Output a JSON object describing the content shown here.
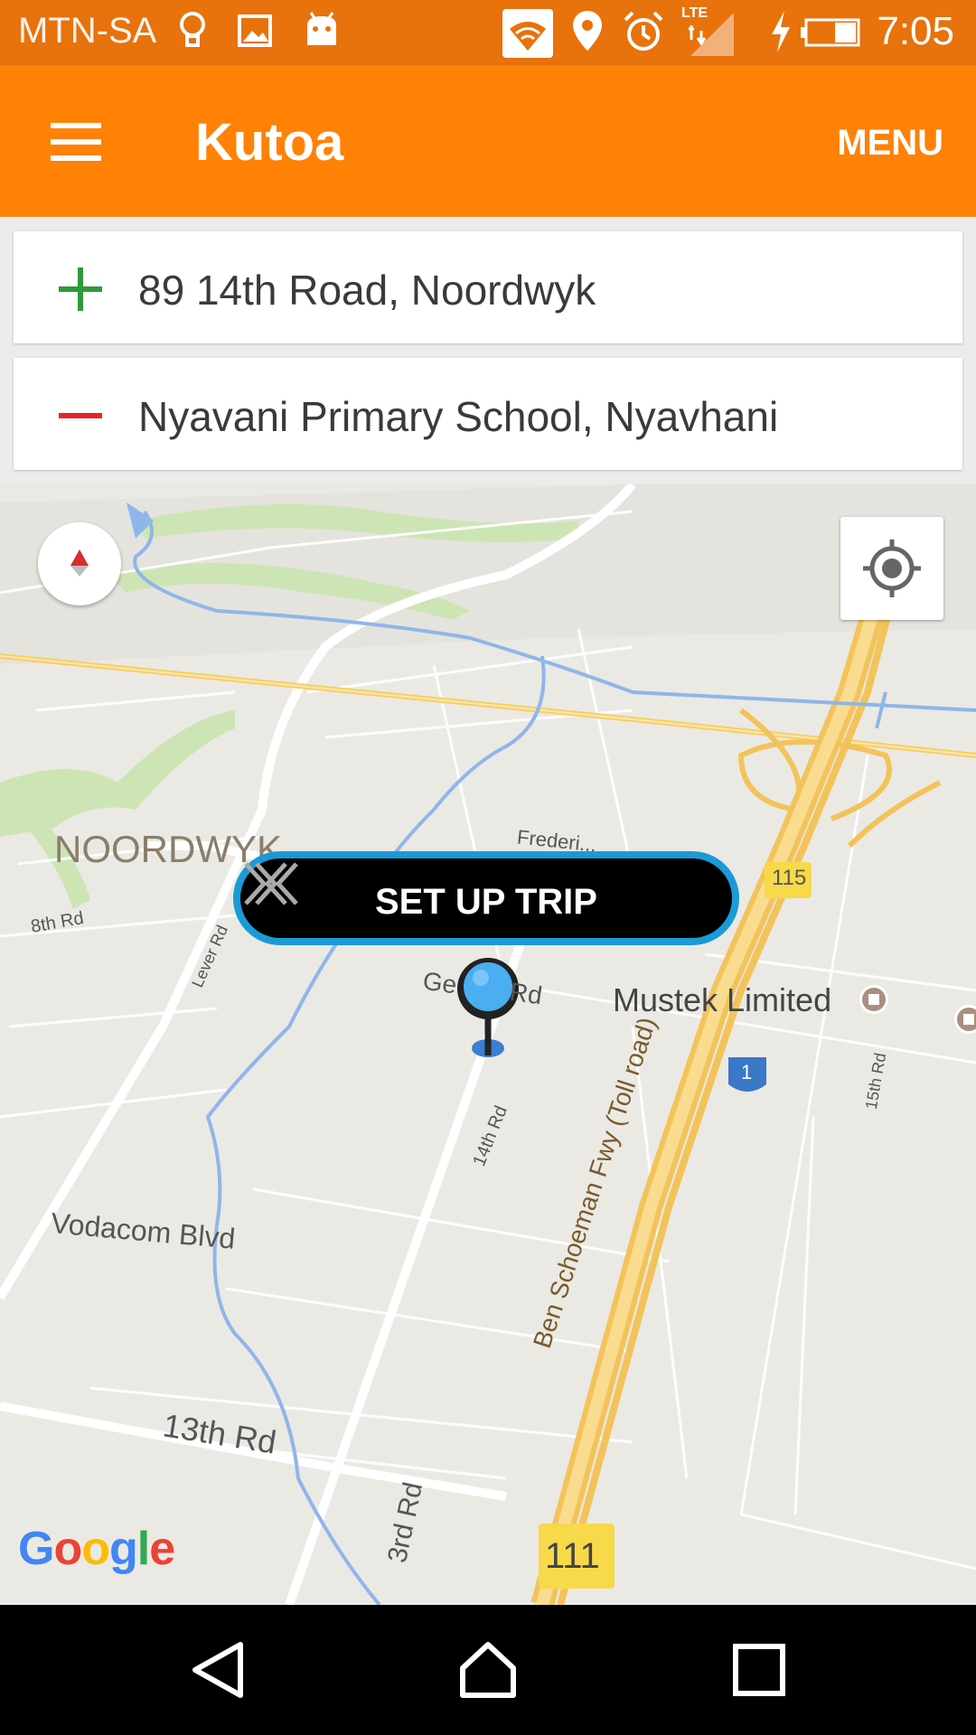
{
  "status_bar": {
    "carrier": "MTN-SA",
    "network": "LTE",
    "time": "7:05"
  },
  "app_bar": {
    "title": "Kutoa",
    "menu_label": "MENU"
  },
  "trip": {
    "origin": "89 14th Road, Noordwyk",
    "destination": "Nyavani Primary School, Nyavhani"
  },
  "map": {
    "setup_button_label": "SET UP TRIP",
    "labels": {
      "suburb": "NOORDWYK",
      "frederick_rd": "Frederi...",
      "eighth_rd": "8th Rd",
      "lever_rd": "Lever Rd",
      "george_rd_a": "Ge",
      "george_rd_b": "Rd",
      "mustek": "Mustek Limited",
      "fourteenth_rd": "14th Rd",
      "fifteenth_rd": "15th Rd",
      "vodacom_blvd": "Vodacom Blvd",
      "thirteenth_rd": "13th Rd",
      "third_rd": "3rd Rd",
      "freeway": "Ben Schoeman Fwy (Toll road)",
      "shield_115": "115",
      "shield_1": "1",
      "shield_111": "111"
    },
    "attribution": {
      "g1": "G",
      "o1": "o",
      "o2": "o",
      "g2": "g",
      "l": "l",
      "e": "e"
    }
  },
  "colors": {
    "status_bar": "#e8720c",
    "app_bar": "#ff8106",
    "add_icon": "#2e9a3a",
    "remove_icon": "#e8232a",
    "trip_button_border": "#1a9ad6",
    "map_background": "#ebe9e4"
  },
  "icons": {
    "status": [
      "bulb-icon",
      "image-icon",
      "android-icon",
      "wifi-icon",
      "location-icon",
      "alarm-icon",
      "signal-icon",
      "charging-icon",
      "battery-icon"
    ],
    "nav": [
      "back-icon",
      "home-icon",
      "recents-icon"
    ]
  }
}
